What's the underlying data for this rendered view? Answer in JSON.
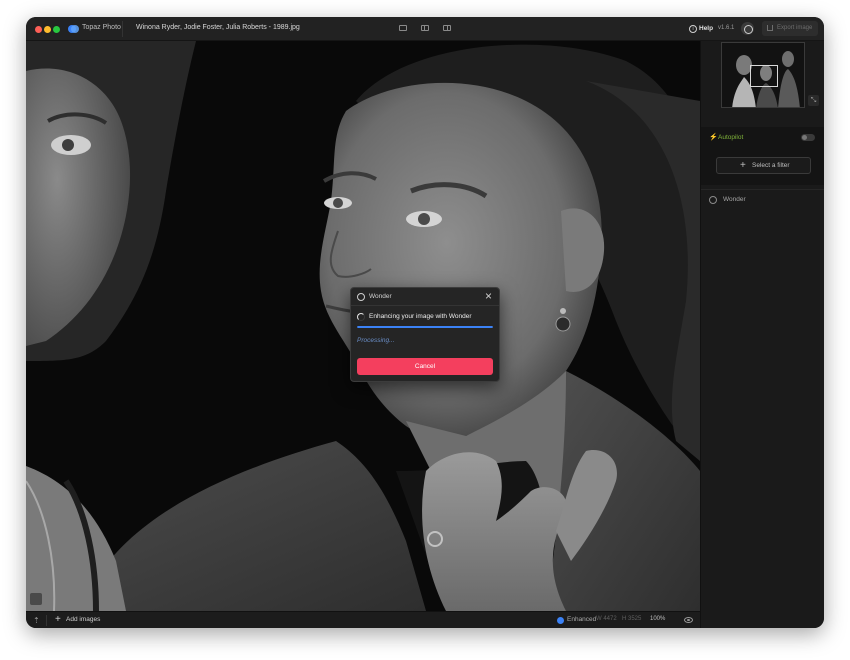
{
  "app": {
    "name": "Topaz Photo",
    "file_title": "Winona Ryder, Jodie Foster, Julia Roberts - 1989.jpg",
    "help_label": "Help",
    "version": "v1.6.1",
    "export_label": "Export image"
  },
  "modal": {
    "title": "Wonder",
    "message": "Enhancing your image with Wonder",
    "status": "Processing...",
    "cancel_label": "Cancel",
    "progress": 1.0
  },
  "panel": {
    "autopilot_label": "Autopilot",
    "autopilot_enabled": false,
    "select_filter_label": "Select a filter",
    "filters": [
      {
        "label": "Wonder"
      }
    ]
  },
  "bottombar": {
    "add_images_label": "Add images",
    "enhanced_label": "Enhanced",
    "width": "W 4472",
    "height": "H 3525",
    "zoom": "100%"
  },
  "colors": {
    "accent_blue": "#3b82f6",
    "cancel_red": "#f43f5e",
    "autopilot_green": "#7fb33a"
  },
  "icons": [
    "app-logo-icon",
    "view-single-icon",
    "view-split-icon",
    "view-side-icon",
    "help-icon",
    "account-icon",
    "export-icon",
    "wonder-icon",
    "close-icon",
    "spinner-icon",
    "bolt-icon",
    "plus-icon",
    "upload-icon",
    "check-icon",
    "eye-icon"
  ]
}
